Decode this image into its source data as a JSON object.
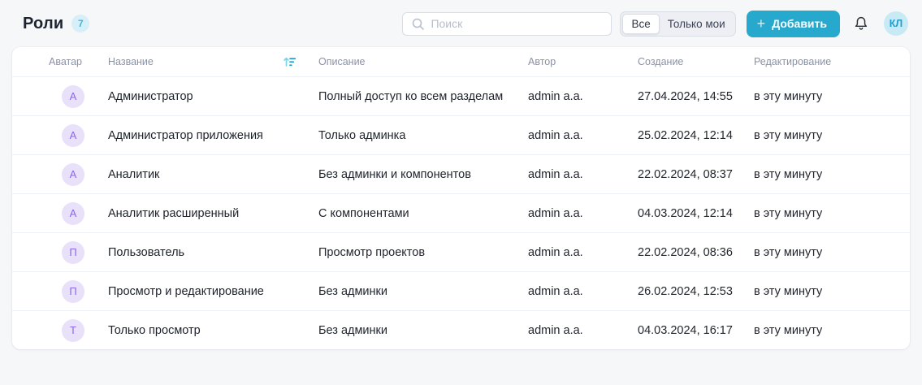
{
  "page": {
    "title": "Роли",
    "badge_count": "7"
  },
  "header": {
    "search_placeholder": "Поиск",
    "filter_all_label": "Все",
    "filter_mine_label": "Только мои",
    "add_button_label": "Добавить",
    "add_button_plus": "+",
    "user_initials": "КЛ"
  },
  "colors": {
    "accent_teal": "#27a9ce",
    "badge_bg": "#d7eff8",
    "badge_text": "#45b6d9",
    "avatar_bg": "#e9e0f9",
    "avatar_text": "#8b68e8",
    "user_avatar_bg": "#c8eaf4",
    "user_avatar_text": "#1f9fd0",
    "page_bg": "#f6f7f9"
  },
  "icons": {
    "search": "search-icon",
    "sort": "sort-ascending-icon",
    "bell": "notification-bell-icon",
    "plus": "plus-icon"
  },
  "table": {
    "columns": [
      "Аватар",
      "Название",
      "Описание",
      "Автор",
      "Создание",
      "Редактирование"
    ],
    "rows": [
      {
        "avatar_letter": "А",
        "name": "Администратор",
        "description": "Полный доступ ко всем разделам",
        "author": "admin a.a.",
        "created": "27.04.2024, 14:55",
        "edited": "в эту минуту"
      },
      {
        "avatar_letter": "А",
        "name": "Администратор приложения",
        "description": "Только админка",
        "author": "admin a.a.",
        "created": "25.02.2024, 12:14",
        "edited": "в эту минуту"
      },
      {
        "avatar_letter": "А",
        "name": "Аналитик",
        "description": "Без админки и компонентов",
        "author": "admin a.a.",
        "created": "22.02.2024, 08:37",
        "edited": "в эту минуту"
      },
      {
        "avatar_letter": "А",
        "name": "Аналитик расширенный",
        "description": "С компонентами",
        "author": "admin a.a.",
        "created": "04.03.2024, 12:14",
        "edited": "в эту минуту"
      },
      {
        "avatar_letter": "П",
        "name": "Пользователь",
        "description": "Просмотр проектов",
        "author": "admin a.a.",
        "created": "22.02.2024, 08:36",
        "edited": "в эту минуту"
      },
      {
        "avatar_letter": "П",
        "name": "Просмотр и редактирование",
        "description": "Без админки",
        "author": "admin a.a.",
        "created": "26.02.2024, 12:53",
        "edited": "в эту минуту"
      },
      {
        "avatar_letter": "Т",
        "name": "Только просмотр",
        "description": "Без админки",
        "author": "admin a.a.",
        "created": "04.03.2024, 16:17",
        "edited": "в эту минуту"
      }
    ]
  }
}
